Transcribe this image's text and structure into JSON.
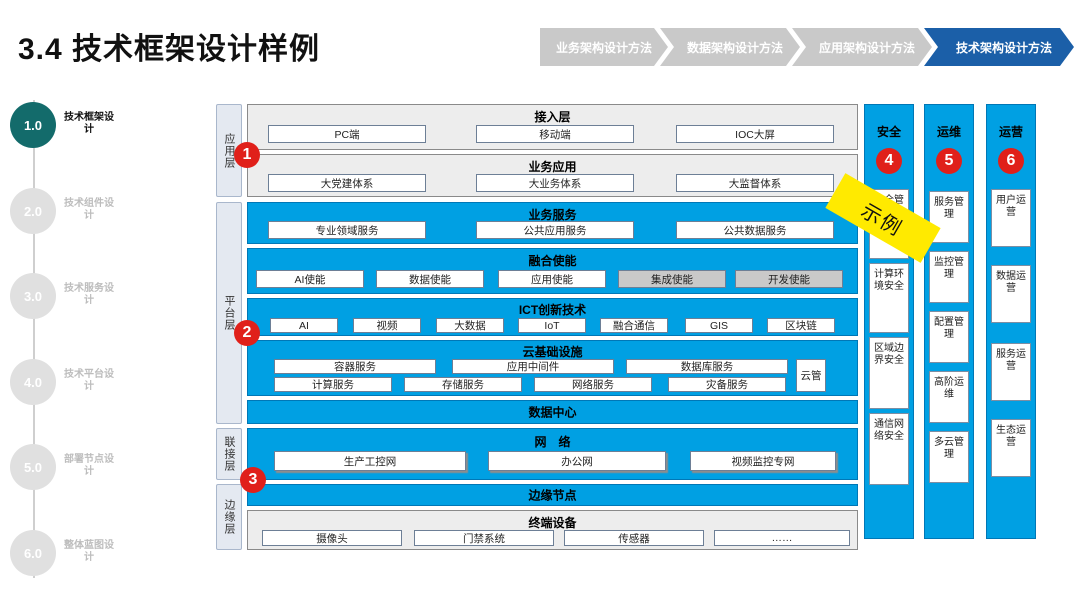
{
  "page_title": "3.4 技术框架设计样例",
  "steps": [
    "业务架构设计方法",
    "数据架构设计方法",
    "应用架构设计方法",
    "技术架构设计方法"
  ],
  "side_nav": [
    {
      "num": "1.0",
      "label": "技术框架设计"
    },
    {
      "num": "2.0",
      "label": "技术组件设计"
    },
    {
      "num": "3.0",
      "label": "技术服务设计"
    },
    {
      "num": "4.0",
      "label": "技术平台设计"
    },
    {
      "num": "5.0",
      "label": "部署节点设计"
    },
    {
      "num": "6.0",
      "label": "整体蓝图设计"
    }
  ],
  "layers": [
    "应用层",
    "平台层",
    "联接层",
    "边缘层"
  ],
  "rows": {
    "access": {
      "title": "接入层",
      "items": [
        "PC端",
        "移动端",
        "IOC大屏"
      ]
    },
    "biz_app": {
      "title": "业务应用",
      "items": [
        "大党建体系",
        "大业务体系",
        "大监督体系"
      ]
    },
    "biz_service": {
      "title": "业务服务",
      "items": [
        "专业领域服务",
        "公共应用服务",
        "公共数据服务"
      ]
    },
    "fusion": {
      "title": "融合使能",
      "items": [
        "AI使能",
        "数据使能",
        "应用使能",
        "集成使能",
        "开发使能"
      ]
    },
    "ict": {
      "title": "ICT创新技术",
      "items": [
        "AI",
        "视频",
        "大数据",
        "IoT",
        "融合通信",
        "GIS",
        "区块链"
      ]
    },
    "cloud": {
      "title": "云基础设施",
      "items": [
        "容器服务",
        "应用中间件",
        "数据库服务",
        "计算服务",
        "存储服务",
        "网络服务",
        "灾备服务"
      ],
      "side": "云管"
    },
    "datacenter": {
      "title": "数据中心"
    },
    "network": {
      "title": "网　络",
      "items": [
        "生产工控网",
        "办公网",
        "视频监控专网"
      ]
    },
    "edge_node": {
      "title": "边缘节点"
    },
    "terminal": {
      "title": "终端设备",
      "items": [
        "摄像头",
        "门禁系统",
        "传感器",
        "……"
      ]
    }
  },
  "columns": {
    "security": {
      "title": "安全",
      "items": [
        "安全管理",
        "计算环境安全",
        "区域边界安全",
        "通信网络安全"
      ]
    },
    "ops": {
      "title": "运维",
      "items": [
        "服务管理",
        "监控管理",
        "配置管理",
        "高阶运维",
        "多云管理"
      ]
    },
    "operation": {
      "title": "运营",
      "items": [
        "用户运营",
        "数据运营",
        "服务运营",
        "生态运营"
      ]
    }
  },
  "markers": [
    "1",
    "2",
    "3",
    "4",
    "5",
    "6"
  ],
  "stamp": "示例",
  "colors": {
    "accent_blue": "#00a0e3",
    "active_step": "#1b5fa8",
    "marker_red": "#e0201a",
    "active_nav": "#136b6b",
    "stamp_yellow": "#ffea00"
  }
}
